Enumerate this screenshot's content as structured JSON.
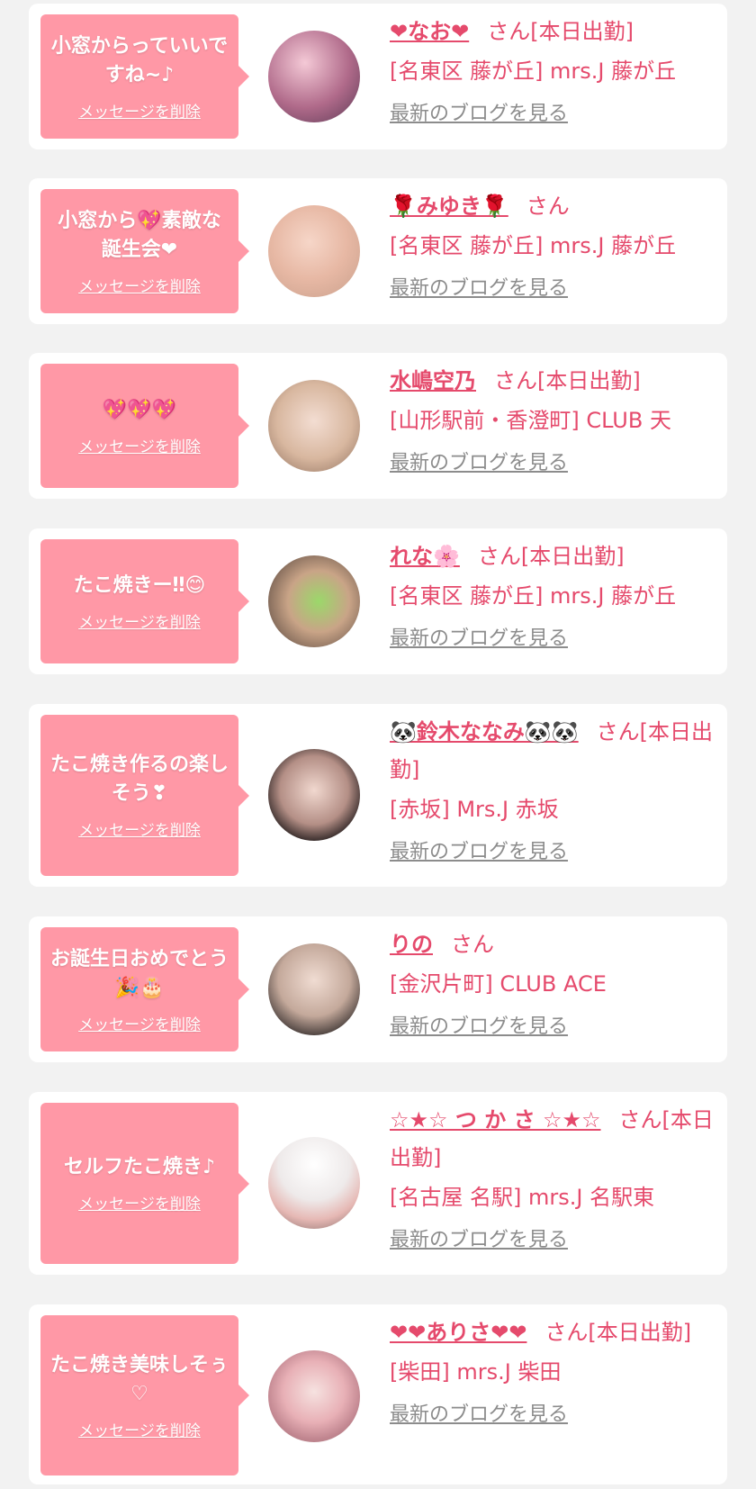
{
  "delete_label": "メッセージを削除",
  "blog_label": "最新のブログを見る",
  "colors": {
    "bubble": "#ff98a6",
    "accent": "#e54a6c",
    "link_gray": "#8c8c8c",
    "background": "#f2f2f2"
  },
  "items": [
    {
      "message": "小窓からっていいですね~♪",
      "name": "❤なお❤",
      "suffix": "さん[本日出勤]",
      "store": "[名東区 藤が丘] mrs.J 藤が丘",
      "avatar": "avatar-photo"
    },
    {
      "message": "小窓から💖素敵な誕生会❤",
      "name": "🌹みゆき🌹",
      "suffix": "さん",
      "store": "[名東区 藤が丘] mrs.J 藤が丘",
      "avatar": "avatar-photo"
    },
    {
      "message": "💖💖💖",
      "name": "水嶋空乃",
      "suffix": "さん[本日出勤]",
      "store": "[山形駅前・香澄町] CLUB 天",
      "avatar": "avatar-photo"
    },
    {
      "message": "たこ焼きー‼😊",
      "name": "れな🌸",
      "suffix": "さん[本日出勤]",
      "store": "[名東区 藤が丘] mrs.J 藤が丘",
      "avatar": "avatar-photo"
    },
    {
      "message": "たこ焼き作るの楽しそう❣",
      "name": "🐼鈴木ななみ🐼🐼",
      "suffix": "さん[本日出勤]",
      "store": "[赤坂] Mrs.J 赤坂",
      "avatar": "avatar-photo"
    },
    {
      "message": "お誕生日おめでとう🎉🎂",
      "name": "りの",
      "suffix": "さん",
      "store": "[金沢片町] CLUB ACE",
      "avatar": "avatar-photo"
    },
    {
      "message": "セルフたこ焼き♪",
      "name": "☆★☆ つ か さ ☆★☆",
      "suffix": "さん[本日出勤]",
      "store": "[名古屋 名駅] mrs.J 名駅東",
      "avatar": "avatar-photo"
    },
    {
      "message": "たこ焼き美味しそぅ♡",
      "name": "❤❤ありさ❤❤",
      "suffix": "さん[本日出勤]",
      "store": "[柴田] mrs.J 柴田",
      "avatar": "avatar-photo"
    }
  ]
}
